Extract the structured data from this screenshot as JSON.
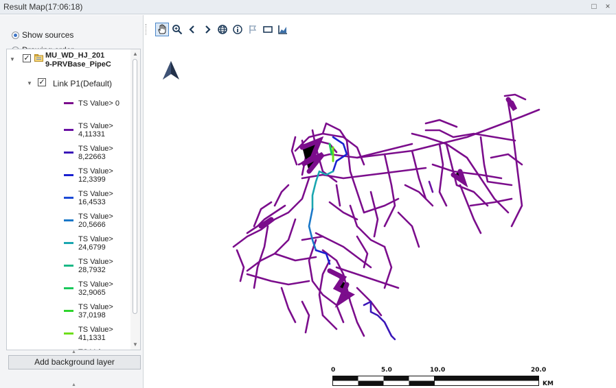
{
  "window": {
    "title": "Result Map(17:06:18)",
    "restore_glyph": "□",
    "close_glyph": "×"
  },
  "sidebar": {
    "options": [
      {
        "label": "Show sources",
        "selected": true
      },
      {
        "label": "Drawing order",
        "selected": false
      }
    ],
    "layer": {
      "name_line1": "MU_WD_HJ_201",
      "name_line2": "9-PRVBase_PipeC",
      "checked": true,
      "expanded": true
    },
    "link": {
      "name": "Link P1(Default)",
      "checked": true
    },
    "legend": [
      {
        "line1": "TS Value> 0",
        "line2": "",
        "color": "#7b0d8c"
      },
      {
        "line1": "TS Value>",
        "line2": "4,11331",
        "color": "#6a10a3"
      },
      {
        "line1": "TS Value>",
        "line2": "8,22663",
        "color": "#3a16b8"
      },
      {
        "line1": "TS Value>",
        "line2": "12,3399",
        "color": "#1a20d0"
      },
      {
        "line1": "TS Value>",
        "line2": "16,4533",
        "color": "#1c4ad6"
      },
      {
        "line1": "TS Value>",
        "line2": "20,5666",
        "color": "#1a78c8"
      },
      {
        "line1": "TS Value>",
        "line2": "24,6799",
        "color": "#1aa6b0"
      },
      {
        "line1": "TS Value>",
        "line2": "28,7932",
        "color": "#1ab886"
      },
      {
        "line1": "TS Value>",
        "line2": "32,9065",
        "color": "#19c85a"
      },
      {
        "line1": "TS Value>",
        "line2": "37,0198",
        "color": "#2ed42c"
      },
      {
        "line1": "TS Value>",
        "line2": "41,1331",
        "color": "#6ede1a"
      },
      {
        "line1": "TS Valu",
        "line2": "",
        "color": "#a0e41a"
      }
    ],
    "add_background_label": "Add background layer"
  },
  "toolbar": {
    "tools": [
      {
        "name": "pan-hand-icon",
        "active": true
      },
      {
        "name": "zoom-icon",
        "active": false
      },
      {
        "name": "back-icon",
        "active": false
      },
      {
        "name": "forward-icon",
        "active": false
      },
      {
        "name": "globe-icon",
        "active": false
      },
      {
        "name": "info-icon",
        "active": false
      },
      {
        "name": "flag-icon",
        "active": false
      },
      {
        "name": "rectangle-icon",
        "active": false
      },
      {
        "name": "chart-icon",
        "active": false
      }
    ]
  },
  "map": {
    "north_arrow": "north-arrow-icon",
    "network_color": "#7b0d8c",
    "scale": {
      "labels": [
        "0",
        "5.0",
        "10.0",
        "20.0"
      ],
      "unit": "KM"
    }
  }
}
